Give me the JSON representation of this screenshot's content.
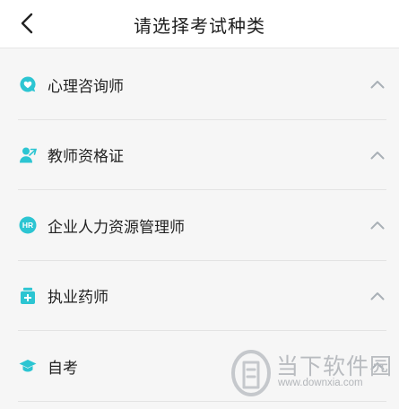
{
  "header": {
    "title": "请选择考试种类",
    "back_icon": "chevron-left-icon"
  },
  "colors": {
    "accent": "#2cc5d2",
    "divider": "#e3e3e3",
    "background": "#f6f6f6",
    "chevron": "#a9b0b6"
  },
  "categories": [
    {
      "label": "心理咨询师",
      "icon": "heart-chat-icon",
      "expanded": true
    },
    {
      "label": "教师资格证",
      "icon": "teacher-icon",
      "expanded": true
    },
    {
      "label": "企业人力资源管理师",
      "icon": "hr-badge-icon",
      "expanded": true
    },
    {
      "label": "执业药师",
      "icon": "medicine-bottle-icon",
      "expanded": true
    },
    {
      "label": "自考",
      "icon": "graduation-cap-icon",
      "expanded": true
    }
  ],
  "hr_badge_text": "HR",
  "watermark": {
    "text": "当下软件园",
    "url": "www.downxia.com"
  }
}
